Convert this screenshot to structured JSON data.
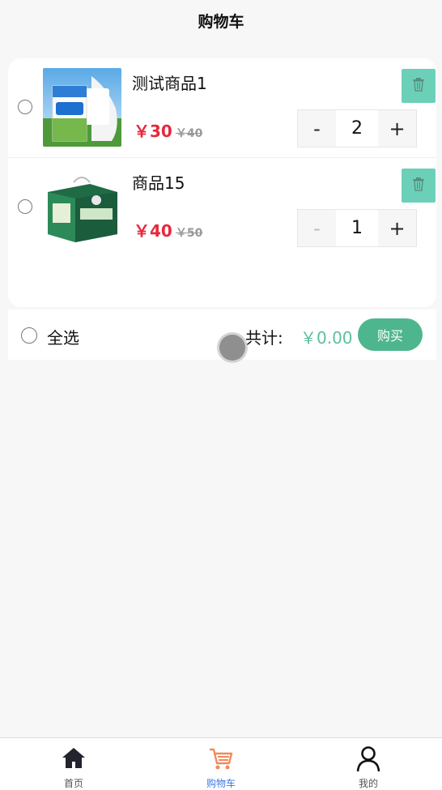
{
  "header": {
    "title": "购物车"
  },
  "cart": {
    "items": [
      {
        "name": "测试商品1",
        "price": "￥30",
        "old_price": "￥40",
        "qty": "2",
        "selected": false,
        "minus": "-",
        "plus": "+"
      },
      {
        "name": "商品15",
        "price": "￥40",
        "old_price": "￥50",
        "qty": "1",
        "selected": false,
        "minus": "-",
        "plus": "+"
      }
    ]
  },
  "summary": {
    "select_all_label": "全选",
    "total_label": "共计:",
    "total_value": "￥0.00",
    "buy_label": "购买"
  },
  "tabbar": {
    "tabs": [
      {
        "label": "首页",
        "icon": "home-icon",
        "active": false
      },
      {
        "label": "购物车",
        "icon": "cart-icon",
        "active": true
      },
      {
        "label": "我的",
        "icon": "user-icon",
        "active": false
      }
    ]
  },
  "colors": {
    "accent": "#4db68e",
    "delete_button": "#6cd0b9",
    "price": "#e8283c",
    "active_tab_label": "#3b78e7",
    "active_tab_icon": "#f08a5d"
  }
}
